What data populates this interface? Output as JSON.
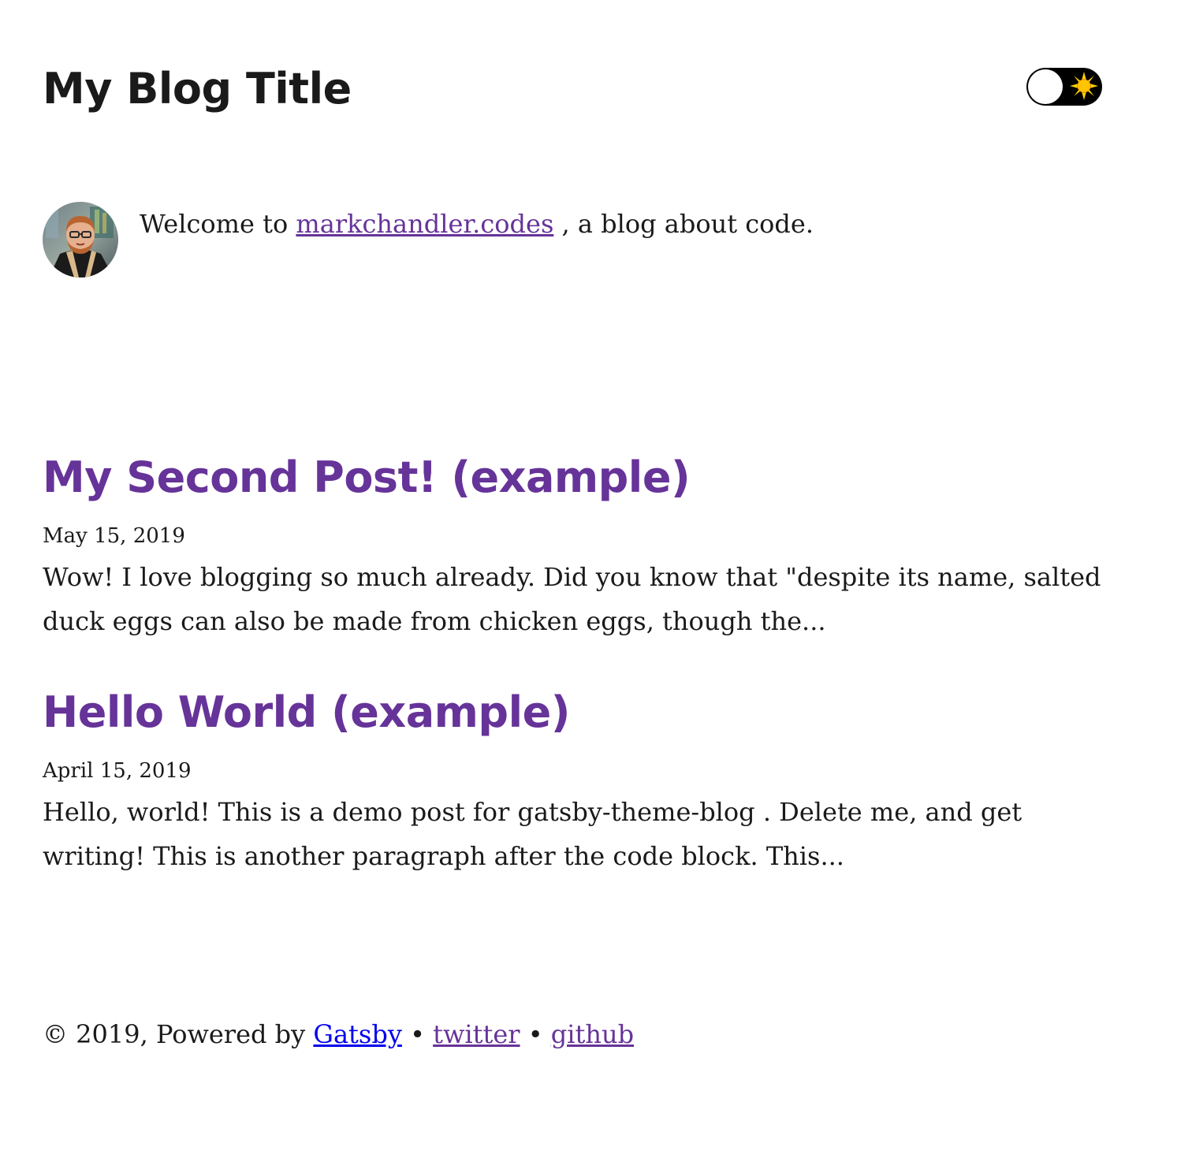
{
  "header": {
    "title": "My Blog Title",
    "theme_toggle": {
      "state": "light",
      "icon": "sun-icon"
    }
  },
  "bio": {
    "avatar": "avatar-photo",
    "prefix": "Welcome to ",
    "link_text": "markchandler.codes",
    "suffix": " , a blog about code."
  },
  "posts": [
    {
      "title": "My Second Post! (example)",
      "date": "May 15, 2019",
      "excerpt": "Wow! I love blogging so much already. Did you know that \"despite its name, salted duck eggs can also be made from chicken eggs, though the..."
    },
    {
      "title": "Hello World (example)",
      "date": "April 15, 2019",
      "excerpt": "Hello, world! This is a demo post for gatsby-theme-blog . Delete me, and get writing! This is another paragraph after the code block. This..."
    }
  ],
  "footer": {
    "copyright": "© 2019, Powered by ",
    "gatsby_link": "Gatsby",
    "separator": " • ",
    "twitter_link": "twitter",
    "github_link": "github"
  },
  "colors": {
    "link_visited": "#663399",
    "link_blue": "#0000ee",
    "text": "#1a1a1a",
    "toggle_bg": "#000000",
    "sun": "#ffd200"
  }
}
